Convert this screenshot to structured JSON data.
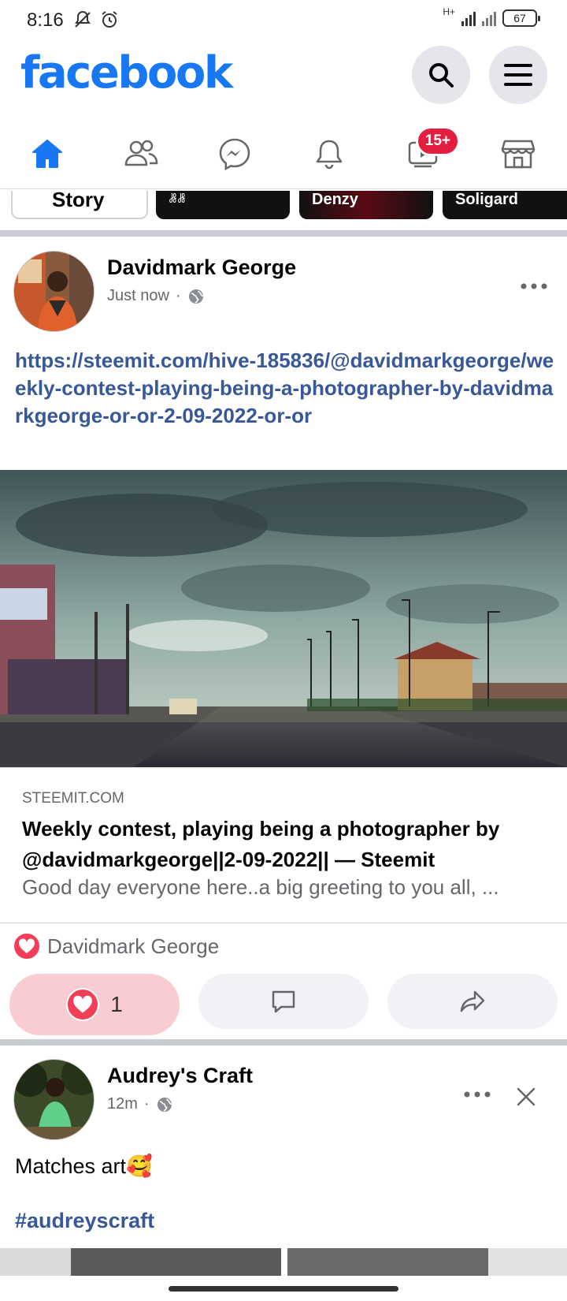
{
  "status_bar": {
    "time": "8:16",
    "network": "H+",
    "battery": "67"
  },
  "header": {
    "logo": "facebook"
  },
  "nav": {
    "video_badge": "15+"
  },
  "stories": {
    "create_label": "Story",
    "items": [
      "ꗡꗡ",
      "Denzy",
      "Soligard"
    ]
  },
  "post1": {
    "author": "Davidmark George",
    "time": "Just now",
    "link_text": "https://steemit.com/hive-185836/@davidmarkgeorge/weekly-contest-playing-being-a-photographer-by-davidmarkgeorge-or-or-2-09-2022-or-or",
    "preview": {
      "domain": "STEEMIT.COM",
      "title": "Weekly contest, playing being a photographer by @davidmarkgeorge||2-09-2022|| — Steemit",
      "description": "Good day everyone here..a big greeting to you all, ..."
    },
    "reactor": "Davidmark George",
    "like_count": "1"
  },
  "post2": {
    "author": "Audrey's Craft",
    "time": "12m",
    "text": "Matches art🥰",
    "hashtag": "#audreyscraft"
  },
  "colors": {
    "brand": "#1877f2",
    "badge": "#e41e3f",
    "link": "#385898",
    "heart": "#f33e58"
  }
}
